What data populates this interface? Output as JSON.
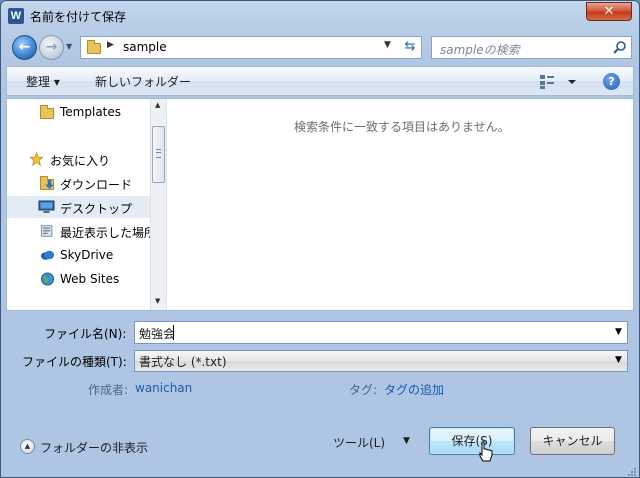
{
  "window": {
    "app_icon": "W",
    "title": "名前を付けて保存",
    "close_label": "✕"
  },
  "address": {
    "path": "sample",
    "search_placeholder": "sampleの検索"
  },
  "toolbar": {
    "organize_label": "整理 ▾",
    "new_folder_label": "新しいフォルダー",
    "help_label": "?"
  },
  "nav": {
    "items": [
      {
        "label": "Templates",
        "icon": "folder-icon"
      },
      {
        "label": "お気に入り",
        "icon": "star-icon"
      },
      {
        "label": "ダウンロード",
        "icon": "download-folder-icon"
      },
      {
        "label": "デスクトップ",
        "icon": "desktop-icon",
        "selected": true
      },
      {
        "label": "最近表示した場所",
        "icon": "recent-places-icon"
      },
      {
        "label": "SkyDrive",
        "icon": "skydrive-icon"
      },
      {
        "label": "Web Sites",
        "icon": "web-sites-icon"
      }
    ]
  },
  "content": {
    "empty_message": "検索条件に一致する項目はありません。"
  },
  "form": {
    "filename_label": "ファイル名(N):",
    "filename_value": "勉強会",
    "filetype_label": "ファイルの種類(T):",
    "filetype_value": "書式なし (*.txt)",
    "author_label": "作成者:",
    "author_value": "wanichan",
    "tags_label": "タグ:",
    "tags_value": "タグの追加"
  },
  "footer": {
    "hide_folders_label": "フォルダーの非表示",
    "tools_label": "ツール(L)",
    "save_label": "保存(S)",
    "cancel_label": "キャンセル"
  },
  "colors": {
    "chrome": "#aec6e3",
    "link": "#1a5ab0",
    "close": "#c43a1b"
  }
}
